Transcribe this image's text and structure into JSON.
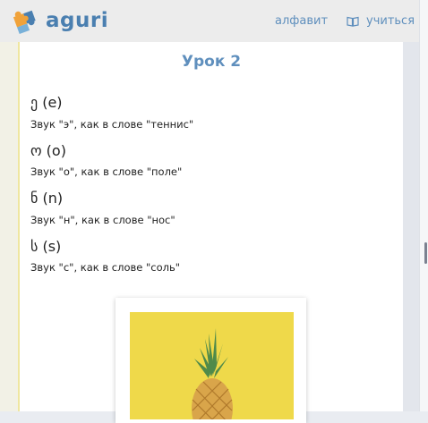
{
  "header": {
    "logo_text": "aguri",
    "nav": {
      "alphabet": "алфавит",
      "learn": "учиться"
    }
  },
  "lesson": {
    "title": "Урок 2",
    "letters": [
      {
        "letter": "ე (e)",
        "description": "Звук \"э\", как в слове \"теннис\""
      },
      {
        "letter": "ო (o)",
        "description": "Звук \"о\", как в слове \"поле\""
      },
      {
        "letter": "ნ (n)",
        "description": "Звук \"н\", как в слове \"нос\""
      },
      {
        "letter": "ს (s)",
        "description": "Звук \"с\", как в слове \"соль\""
      }
    ]
  },
  "colors": {
    "accent": "#5f8fbd",
    "logo_orange": "#f0a23a",
    "logo_blue": "#4a7fb0",
    "photo_background": "#efd94a"
  },
  "icons": {
    "logo": "puzzle-logo-icon",
    "learn": "book-icon"
  }
}
